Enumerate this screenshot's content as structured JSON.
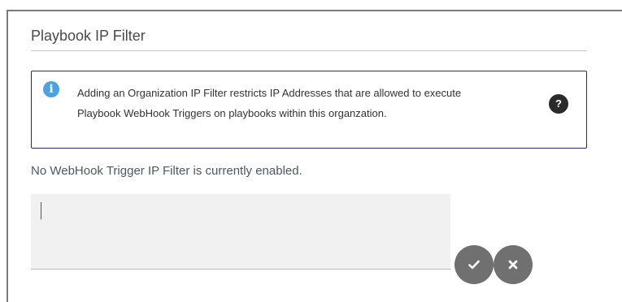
{
  "panel": {
    "title": "Playbook IP Filter"
  },
  "info": {
    "icon": "info-icon",
    "line1": "Adding an Organization IP Filter restricts IP Addresses that are allowed to execute",
    "line2": "Playbook WebHook Triggers on playbooks within this organzation.",
    "help_icon": "question-icon",
    "help_label": "?"
  },
  "status_text": "No WebHook Trigger IP Filter is currently enabled.",
  "ip_input": {
    "value": "",
    "placeholder": ""
  },
  "actions": {
    "confirm_icon": "check-icon",
    "cancel_icon": "close-icon"
  },
  "colors": {
    "info_border": "#2e2a6a",
    "info_icon": "#4aa3df",
    "button": "#707070",
    "help_icon_bg": "#2b2b2b"
  }
}
